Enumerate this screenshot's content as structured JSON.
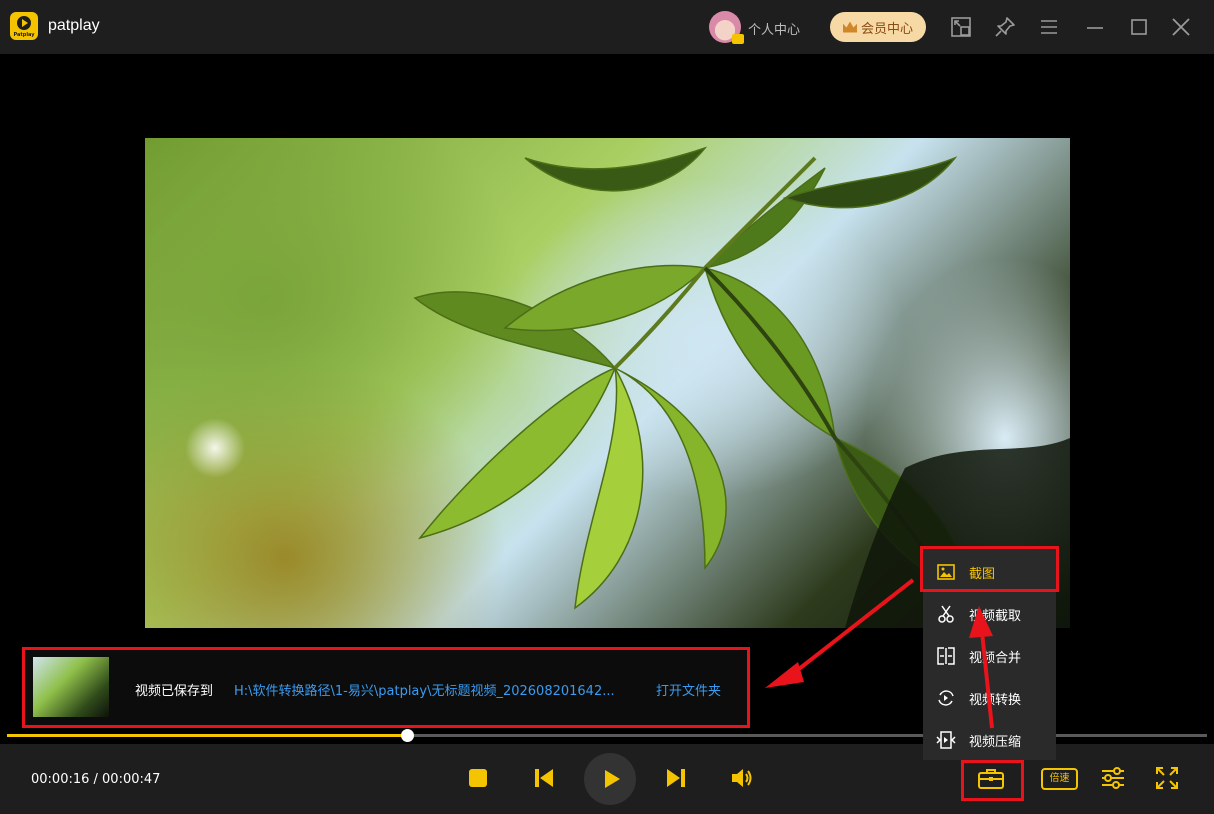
{
  "app": {
    "name": "patplay",
    "logo_text": "Patplay"
  },
  "header": {
    "profile_label": "个人中心",
    "vip_label": "会员中心",
    "icons": [
      "picture-in-picture-icon",
      "pin-icon",
      "menu-icon",
      "minimize-icon",
      "maximize-icon",
      "close-icon"
    ]
  },
  "notification": {
    "saved_label": "视频已保存到",
    "saved_path": "H:\\软件转换路径\\1-易兴\\patplay\\无标题视频_202608201642...",
    "open_folder": "打开文件夹"
  },
  "playback": {
    "current_time": "00:00:16",
    "total_time": "00:00:47",
    "time_display": "00:00:16 / 00:00:47",
    "progress_fraction": 0.333,
    "speed_label": "倍速"
  },
  "tools_menu": {
    "items": [
      {
        "label": "截图",
        "icon": "screenshot-icon",
        "active": true
      },
      {
        "label": "视频截取",
        "icon": "scissors-icon",
        "active": false
      },
      {
        "label": "视频合并",
        "icon": "merge-icon",
        "active": false
      },
      {
        "label": "视频转换",
        "icon": "convert-icon",
        "active": false
      },
      {
        "label": "视频压缩",
        "icon": "compress-icon",
        "active": false
      }
    ]
  },
  "colors": {
    "accent": "#f5c400",
    "link": "#3a9bf0",
    "annotation_red": "#e8131b",
    "titlebar_bg": "#1e1e1e"
  }
}
